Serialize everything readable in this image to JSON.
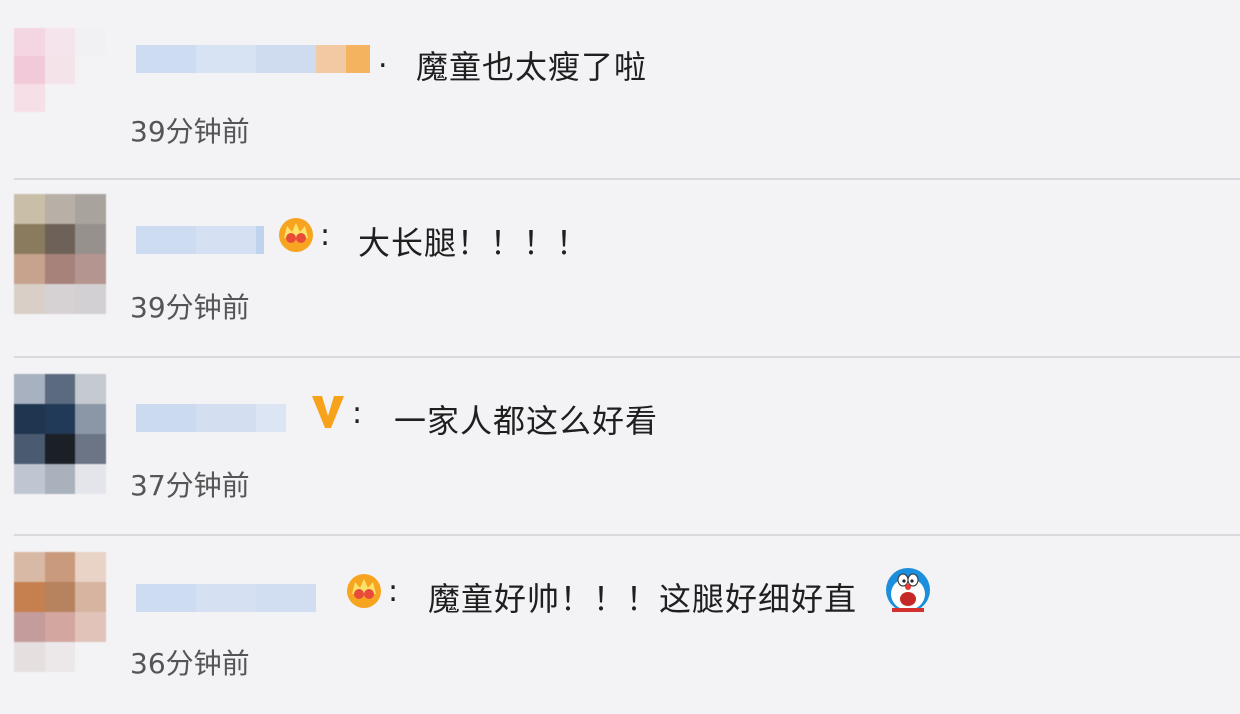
{
  "comments": [
    {
      "text": "魔童也太瘦了啦",
      "separator": ".",
      "time": "39分钟前",
      "badge": null
    },
    {
      "text": "大长腿！！！！",
      "separator": ":",
      "time": "39分钟前",
      "badge": "crown-icon"
    },
    {
      "text": "一家人都这么好看",
      "separator": ":",
      "time": "37分钟前",
      "badge": "verified-v-icon"
    },
    {
      "text": "魔童好帅！！！这腿好细好直",
      "separator": ":",
      "time": "36分钟前",
      "badge": "crown-icon",
      "trailing_emoji": "doraemon-emoji"
    }
  ],
  "colors": {
    "background": "#f3f2f5",
    "blur_blue": "#c7d8ee",
    "accent_orange": "#f6a53a"
  }
}
